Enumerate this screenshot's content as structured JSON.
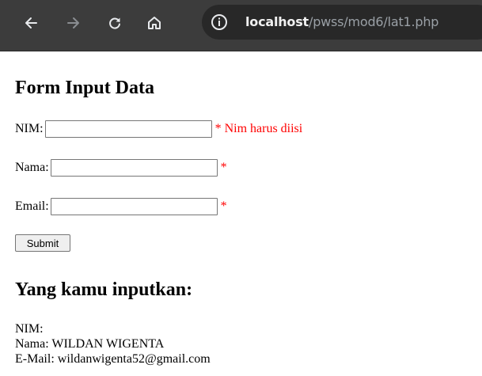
{
  "browser": {
    "url_host": "localhost",
    "url_path": "/pwss/mod6/lat1.php"
  },
  "form": {
    "title": "Form Input Data",
    "nim_label": "NIM:",
    "nim_value": "",
    "nim_error": "* Nim harus diisi",
    "nama_label": "Nama:",
    "nama_value": "",
    "nama_required": "*",
    "email_label": "Email:",
    "email_value": "",
    "email_required": "*",
    "submit_label": "Submit"
  },
  "result": {
    "title": "Yang kamu inputkan:",
    "nim_line": "NIM:",
    "nama_line": "Nama: WILDAN WIGENTA",
    "email_line": "E-Mail: wildanwigenta52@gmail.com"
  },
  "colors": {
    "error": "#ff0000",
    "toolbar": "#3c3c3c"
  }
}
